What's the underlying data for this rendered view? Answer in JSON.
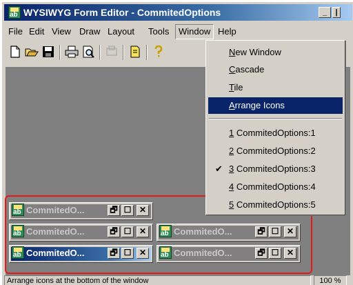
{
  "window": {
    "title": "WYSIWYG Form Editor - CommitedOptions",
    "minimize_glyph": "_",
    "close_glyph": "|"
  },
  "menubar": {
    "items": [
      "File",
      "Edit",
      "View",
      "Draw",
      "Layout",
      "Tools",
      "Window",
      "Help"
    ]
  },
  "toolbar": {
    "icons": [
      "new-icon",
      "open-icon",
      "save-icon",
      "print-icon",
      "print-preview-icon",
      "disabled-icon",
      "properties-icon",
      "help-icon"
    ]
  },
  "window_menu": {
    "items": [
      {
        "mnemonic": "N",
        "rest": "ew Window"
      },
      {
        "mnemonic": "C",
        "rest": "ascade"
      },
      {
        "mnemonic": "T",
        "rest": "ile"
      },
      {
        "mnemonic": "A",
        "rest": "rrange Icons"
      }
    ],
    "windows": [
      {
        "mnemonic": "1",
        "rest": " CommitedOptions:1",
        "checked": false
      },
      {
        "mnemonic": "2",
        "rest": " CommitedOptions:2",
        "checked": false
      },
      {
        "mnemonic": "3",
        "rest": " CommitedOptions:3",
        "checked": true
      },
      {
        "mnemonic": "4",
        "rest": " CommitedOptions:4",
        "checked": false
      },
      {
        "mnemonic": "5",
        "rest": " CommitedOptions:5",
        "checked": false
      }
    ],
    "check_mark": "✔"
  },
  "minimized_windows": [
    {
      "label": "CommitedO...",
      "active": false
    },
    {
      "label": "CommitedO...",
      "active": false
    },
    {
      "label": "CommitedO...",
      "active": false
    },
    {
      "label": "CommitedO...",
      "active": true
    },
    {
      "label": "CommitedO...",
      "active": false
    }
  ],
  "mini_buttons": {
    "restore": "🗗",
    "maximize": "☐",
    "close": "✕"
  },
  "app_icon_text": "ab",
  "status": {
    "text": "Arrange icons at the bottom of the window",
    "zoom": "100 %"
  },
  "colors": {
    "title_active": "#0a246a",
    "highlight_border": "#e21a1a",
    "mdi_background": "#808080"
  }
}
